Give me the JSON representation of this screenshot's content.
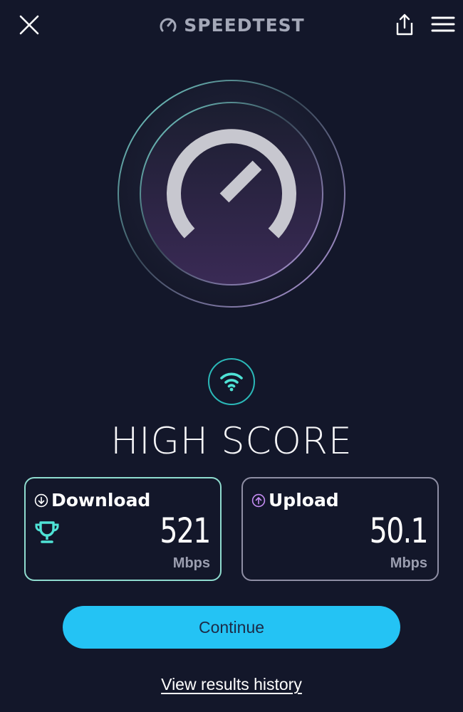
{
  "header": {
    "title": "SPEEDTEST",
    "icons": [
      "close-icon",
      "speedometer-icon",
      "share-icon",
      "menu-icon"
    ]
  },
  "gauge": {
    "icon": "speedometer-icon"
  },
  "connection": {
    "icon": "wifi-icon"
  },
  "result": {
    "title": "HIGH SCORE"
  },
  "download": {
    "label": "Download",
    "value": "521",
    "unit": "Mbps",
    "icons": [
      "arrow-down-icon",
      "trophy-icon"
    ]
  },
  "upload": {
    "label": "Upload",
    "value": "50.1",
    "unit": "Mbps",
    "icons": [
      "arrow-up-icon"
    ]
  },
  "actions": {
    "continue_label": "Continue",
    "history_label": "View results history"
  },
  "colors": {
    "background": "#13172a",
    "accent_cyan": "#24c3f4",
    "download_teal": "#8fdccf",
    "upload_purple": "#c48cf2",
    "wifi_teal": "#4fe3d6"
  }
}
